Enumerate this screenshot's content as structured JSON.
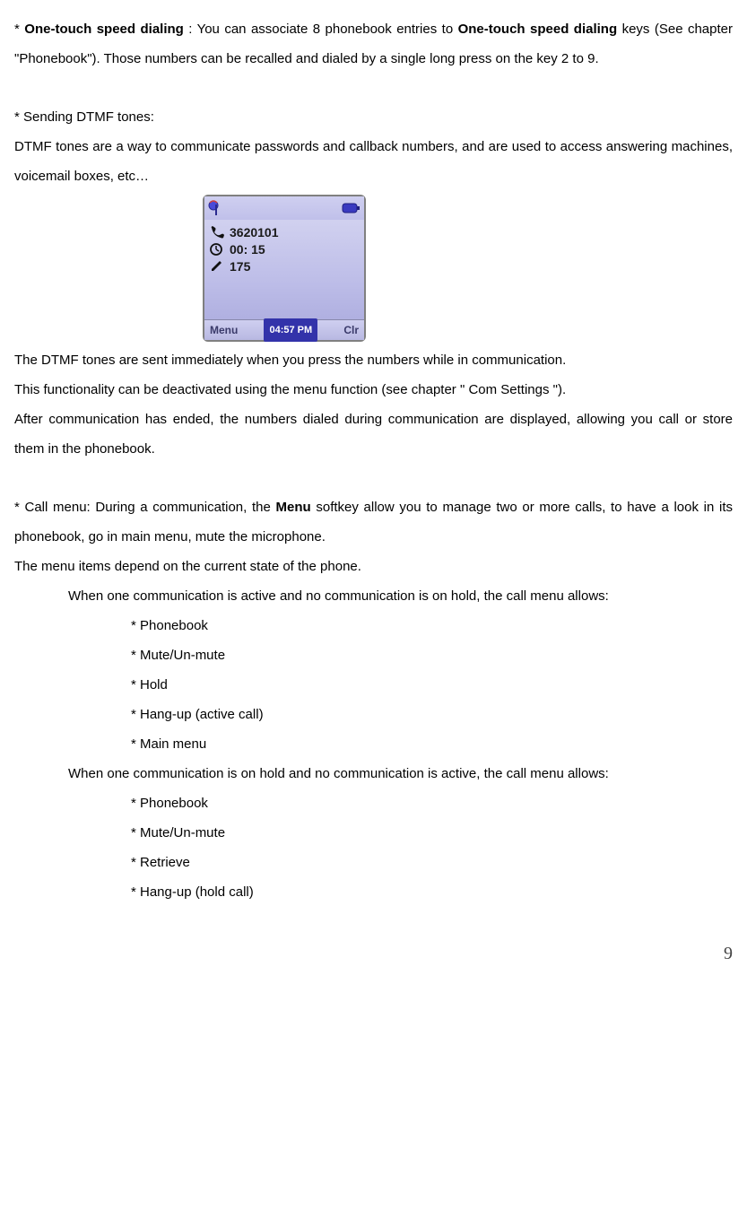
{
  "p1": {
    "prefix": "* ",
    "bold1": "One-touch speed dialing",
    "mid": " :  You can associate 8 phonebook entries to ",
    "bold2": "One-touch speed dialing",
    "rest": " keys (See chapter \"Phonebook\"). Those numbers can be recalled and dialed by a single long press on the key 2 to 9."
  },
  "p2": "* Sending DTMF tones:",
  "p3": "DTMF tones are a way to communicate passwords and callback numbers, and are used to access answering machines, voicemail boxes, etc…",
  "phone": {
    "number": "3620101",
    "duration": "00: 15",
    "dtmf": "175",
    "soft_left": "Menu",
    "time": "04:57 PM",
    "soft_right": "Clr"
  },
  "p4": "The DTMF tones are sent immediately when you press the numbers while in communication.",
  "p5": "This functionality can be deactivated using the menu function (see chapter \" Com Settings \").",
  "p6": "After communication has ended, the numbers dialed during communication are displayed, allowing you call or store them in the phonebook.",
  "p7": {
    "prefix": "* Call menu: During a communication, the ",
    "bold": "Menu",
    "rest": " softkey allow you to manage two or more calls, to have a look in its phonebook, go in main menu, mute the microphone."
  },
  "p8": "The menu items depend on the current state of the phone.",
  "l1_intro1": "When one communication is active and no communication is on hold, the call menu allows:",
  "list1": {
    "i0": "* Phonebook",
    "i1": "* Mute/Un-mute",
    "i2": "* Hold",
    "i3": "* Hang-up (active call)",
    "i4": "* Main menu"
  },
  "l2_intro": "When one communication is on hold and no communication is active, the call menu allows:",
  "list2": {
    "i0": "* Phonebook",
    "i1": "* Mute/Un-mute",
    "i2": "* Retrieve",
    "i3": "* Hang-up (hold call)"
  },
  "page_number": "9"
}
